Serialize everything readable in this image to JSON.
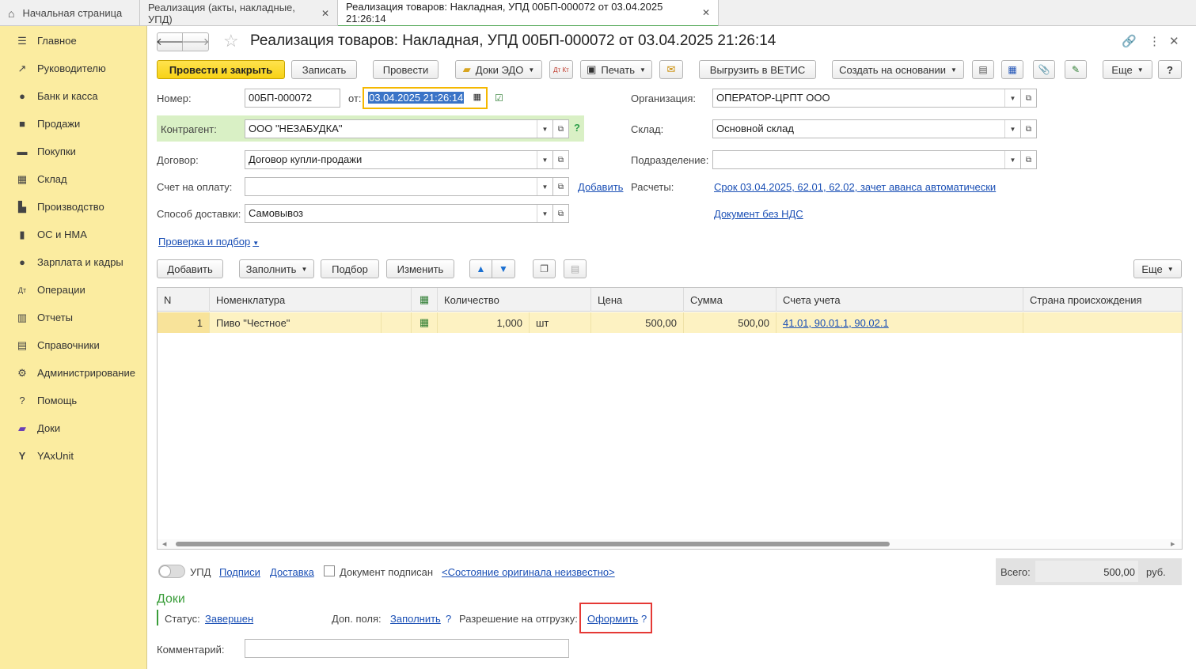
{
  "tabs": {
    "home": "Начальная страница",
    "tab1": "Реализация (акты, накладные, УПД)",
    "tab2": "Реализация товаров: Накладная, УПД 00БП-000072 от 03.04.2025 21:26:14",
    "close": "✕"
  },
  "sidebar": {
    "items": [
      {
        "label": "Главное",
        "icon": "menu-icon"
      },
      {
        "label": "Руководителю",
        "icon": "trend-icon"
      },
      {
        "label": "Банк и касса",
        "icon": "coin-icon"
      },
      {
        "label": "Продажи",
        "icon": "bag-icon"
      },
      {
        "label": "Покупки",
        "icon": "cart-icon"
      },
      {
        "label": "Склад",
        "icon": "warehouse-icon"
      },
      {
        "label": "Производство",
        "icon": "factory-icon"
      },
      {
        "label": "ОС и НМА",
        "icon": "truck-icon"
      },
      {
        "label": "Зарплата и кадры",
        "icon": "person-icon"
      },
      {
        "label": "Операции",
        "icon": "dt-kt-icon"
      },
      {
        "label": "Отчеты",
        "icon": "bar-chart-icon"
      },
      {
        "label": "Справочники",
        "icon": "book-icon"
      },
      {
        "label": "Администрирование",
        "icon": "gear-icon"
      },
      {
        "label": "Помощь",
        "icon": "question-icon"
      },
      {
        "label": "Доки",
        "icon": "folder-icon"
      },
      {
        "label": "YAxUnit",
        "icon": "yaxunit-icon"
      }
    ]
  },
  "header": {
    "title": "Реализация товаров: Накладная, УПД 00БП-000072 от 03.04.2025 21:26:14"
  },
  "toolbar": {
    "post_close": "Провести и закрыть",
    "save": "Записать",
    "post": "Провести",
    "edo": "Доки ЭДО",
    "dtkt": "Дт Кт",
    "print": "Печать",
    "vetis": "Выгрузить в ВЕТИС",
    "create_based": "Создать на основании",
    "more": "Еще",
    "help": "?"
  },
  "form": {
    "number_label": "Номер:",
    "number": "00БП-000072",
    "from_label": "от:",
    "date": "03.04.2025 21:26:14",
    "org_label": "Организация:",
    "org": "ОПЕРАТОР-ЦРПТ ООО",
    "counterparty_label": "Контрагент:",
    "counterparty": "ООО \"НЕЗАБУДКА\"",
    "warehouse_label": "Склад:",
    "warehouse": "Основной склад",
    "contract_label": "Договор:",
    "contract": "Договор купли-продажи",
    "division_label": "Подразделение:",
    "division": "",
    "invoice_label": "Счет на оплату:",
    "invoice": "",
    "add_link": "Добавить",
    "settlements_label": "Расчеты:",
    "settlements_link": "Срок 03.04.2025, 62.01, 62.02, зачет аванса автоматически",
    "delivery_label": "Способ доставки:",
    "delivery": "Самовывоз",
    "vat_link": "Документ без НДС",
    "check_link": "Проверка и подбор",
    "q": "?"
  },
  "table_toolbar": {
    "add": "Добавить",
    "fill": "Заполнить",
    "select": "Подбор",
    "change": "Изменить",
    "more": "Еще"
  },
  "table": {
    "headers": [
      "N",
      "Номенклатура",
      "Количество",
      "Цена",
      "Сумма",
      "Счета учета",
      "Страна происхождения"
    ],
    "rows": [
      {
        "n": "1",
        "item": "Пиво \"Честное\"",
        "qty": "1,000",
        "unit": "шт",
        "price": "500,00",
        "sum": "500,00",
        "accounts": "41.01, 90.01.1, 90.02.1",
        "country": ""
      }
    ]
  },
  "footer": {
    "upd": "УПД",
    "signatures": "Подписи",
    "delivery": "Доставка",
    "signed": "Документ подписан",
    "original_state": "<Состояние оригинала неизвестно>",
    "total_label": "Всего:",
    "total": "500,00",
    "currency": "руб.",
    "docs_title": "Доки",
    "status_label": "Статус:",
    "status": "Завершен",
    "extra_label": "Доп. поля:",
    "extra_fill": "Заполнить",
    "shipment_label": "Разрешение на отгрузку:",
    "shipment_link": "Оформить",
    "comment_label": "Комментарий:",
    "comment": ""
  },
  "colors": {
    "sidebar": "#fbeca0",
    "accent_yellow": "#f7d216",
    "link": "#1a4fb5",
    "highlight_red": "#e53935",
    "green": "#43a047"
  }
}
